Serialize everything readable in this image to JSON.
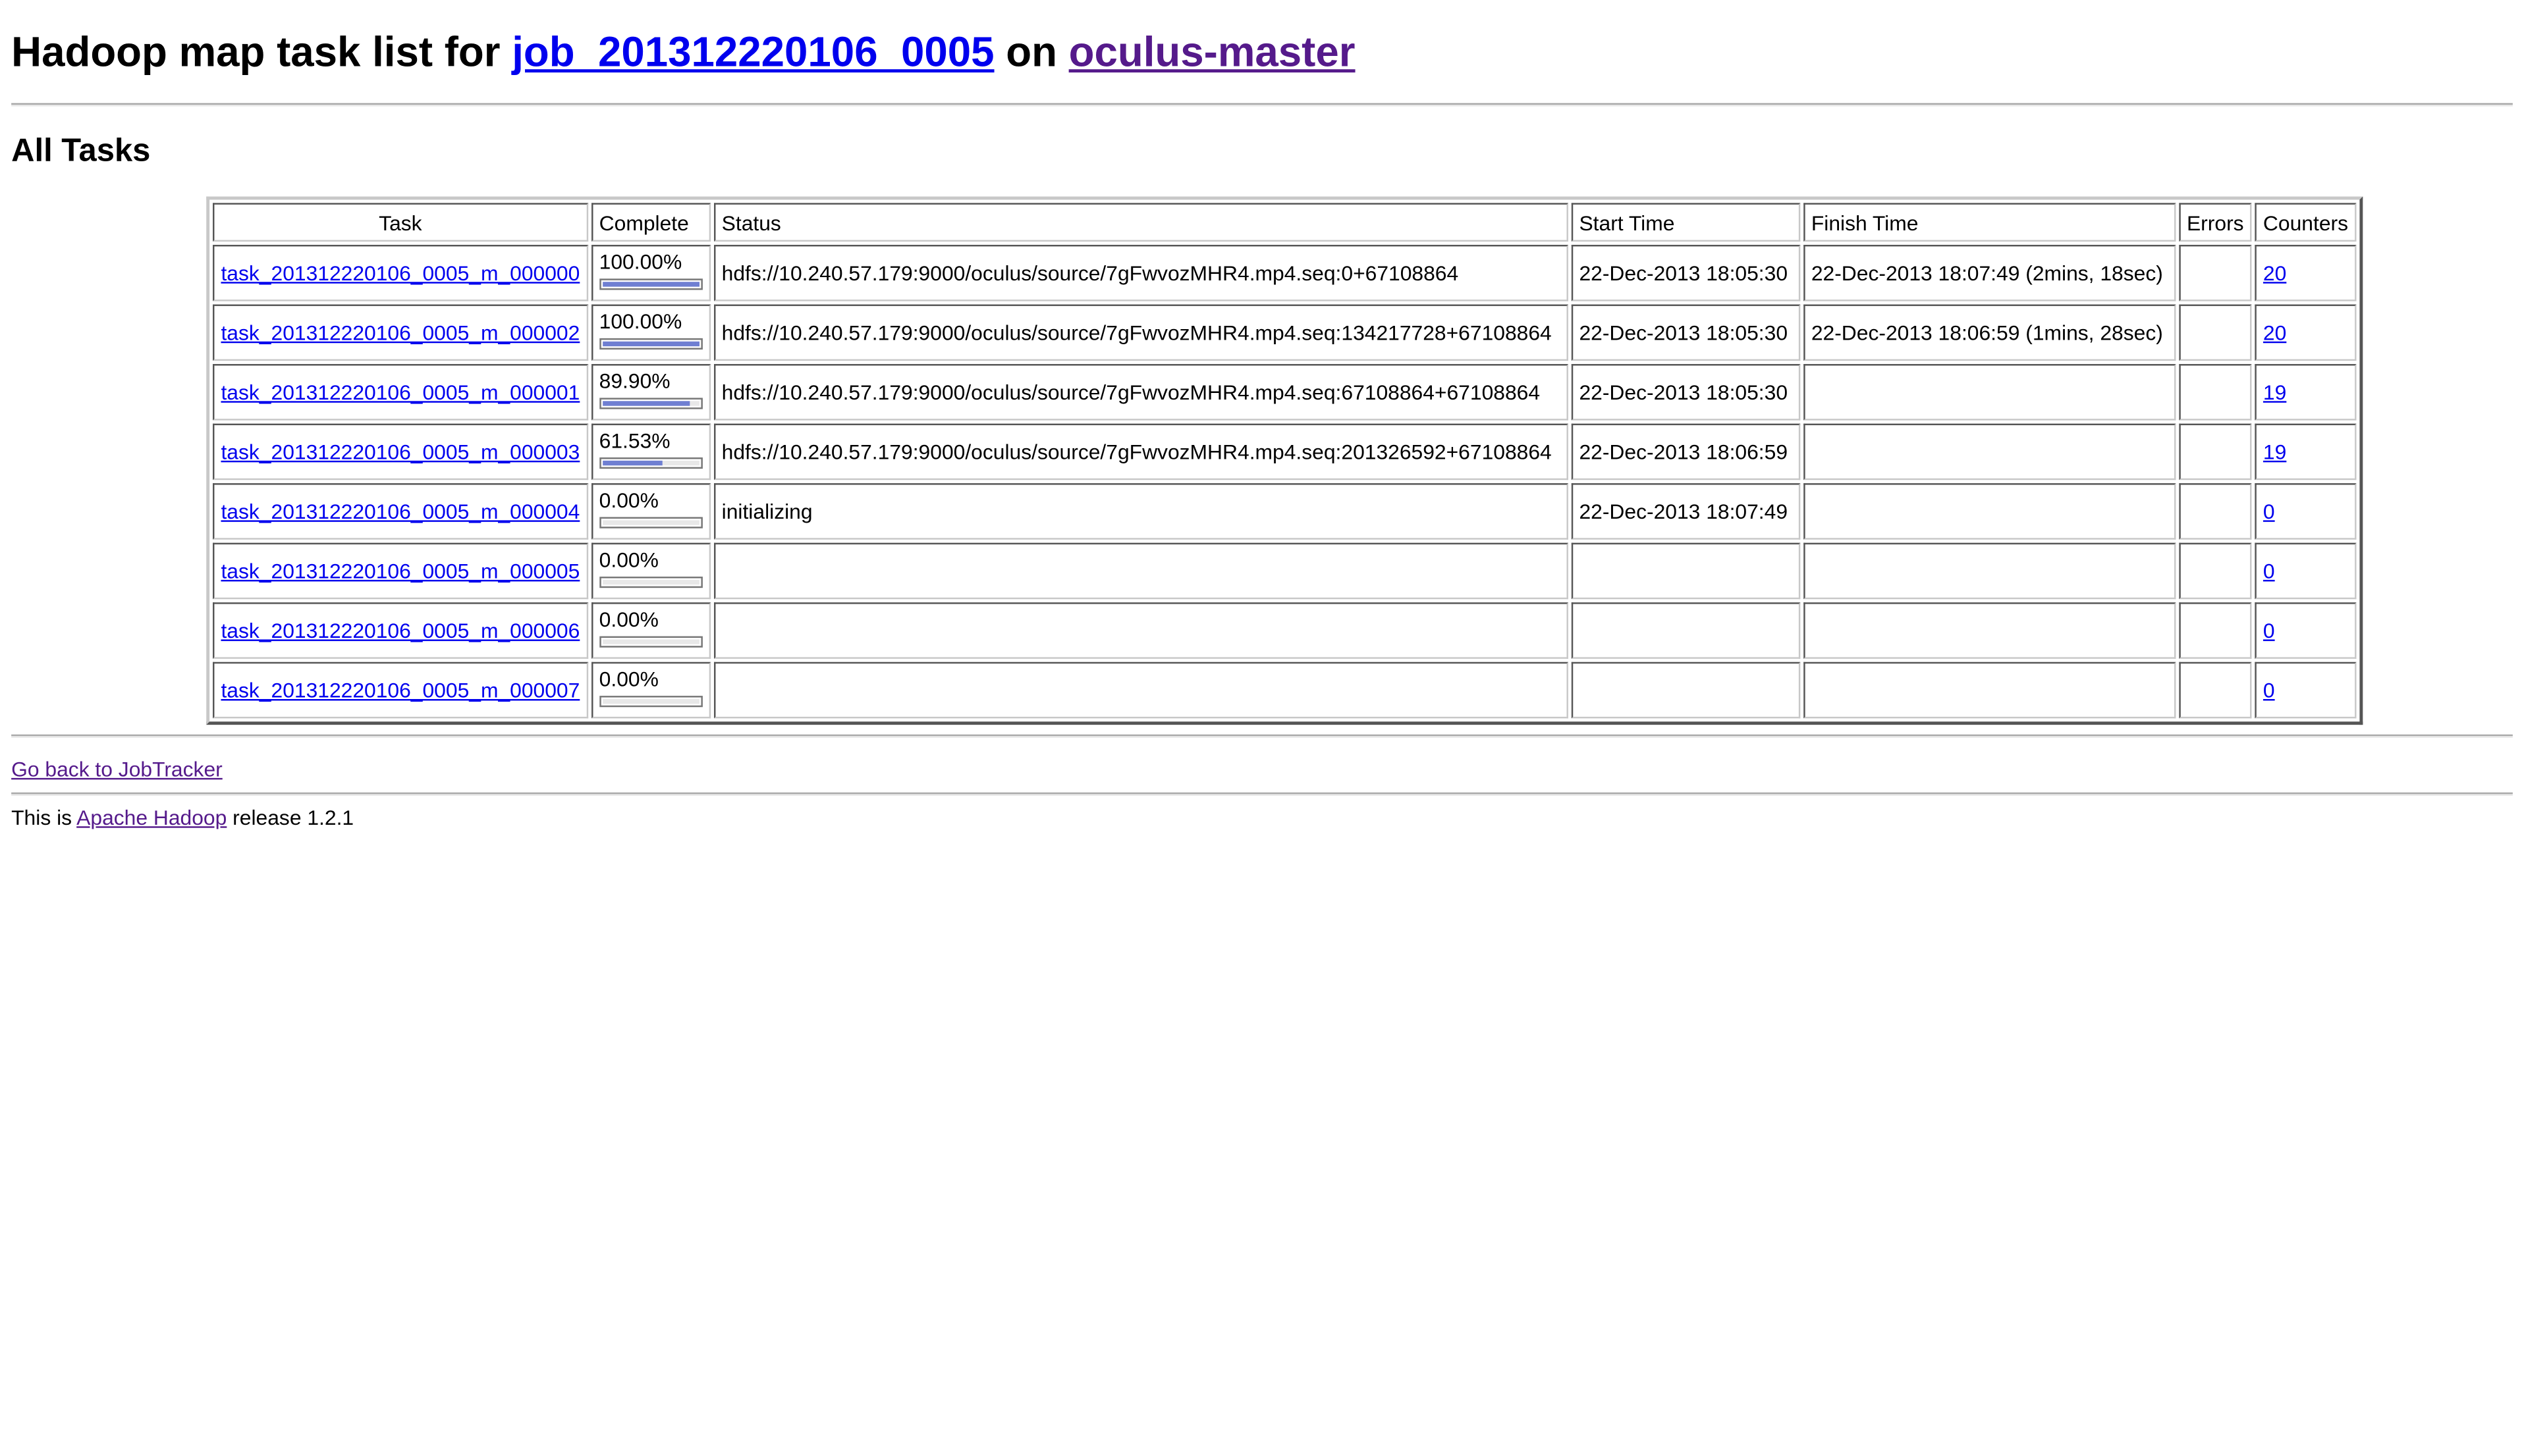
{
  "header": {
    "title_prefix": "Hadoop map task list for ",
    "job_link": "job_201312220106_0005",
    "title_middle": " on ",
    "host_link": "oculus-master"
  },
  "section": {
    "heading": "All Tasks"
  },
  "table": {
    "columns": {
      "task": "Task",
      "complete": "Complete",
      "status": "Status",
      "start_time": "Start Time",
      "finish_time": "Finish Time",
      "errors": "Errors",
      "counters": "Counters"
    },
    "rows": [
      {
        "task": "task_201312220106_0005_m_000000",
        "complete": "100.00%",
        "progress": 1.0,
        "status": "hdfs://10.240.57.179:9000/oculus/source/7gFwvozMHR4.mp4.seq:0+67108864",
        "start_time": "22-Dec-2013 18:05:30",
        "finish_time": "22-Dec-2013 18:07:49 (2mins, 18sec)",
        "errors": "",
        "counters": "20"
      },
      {
        "task": "task_201312220106_0005_m_000002",
        "complete": "100.00%",
        "progress": 1.0,
        "status": "hdfs://10.240.57.179:9000/oculus/source/7gFwvozMHR4.mp4.seq:134217728+67108864",
        "start_time": "22-Dec-2013 18:05:30",
        "finish_time": "22-Dec-2013 18:06:59 (1mins, 28sec)",
        "errors": "",
        "counters": "20"
      },
      {
        "task": "task_201312220106_0005_m_000001",
        "complete": "89.90%",
        "progress": 0.899,
        "status": "hdfs://10.240.57.179:9000/oculus/source/7gFwvozMHR4.mp4.seq:67108864+67108864",
        "start_time": "22-Dec-2013 18:05:30",
        "finish_time": "",
        "errors": "",
        "counters": "19"
      },
      {
        "task": "task_201312220106_0005_m_000003",
        "complete": "61.53%",
        "progress": 0.6153,
        "status": "hdfs://10.240.57.179:9000/oculus/source/7gFwvozMHR4.mp4.seq:201326592+67108864",
        "start_time": "22-Dec-2013 18:06:59",
        "finish_time": "",
        "errors": "",
        "counters": "19"
      },
      {
        "task": "task_201312220106_0005_m_000004",
        "complete": "0.00%",
        "progress": 0.0,
        "status": "initializing",
        "start_time": "22-Dec-2013 18:07:49",
        "finish_time": "",
        "errors": "",
        "counters": "0"
      },
      {
        "task": "task_201312220106_0005_m_000005",
        "complete": "0.00%",
        "progress": 0.0,
        "status": "",
        "start_time": "",
        "finish_time": "",
        "errors": "",
        "counters": "0"
      },
      {
        "task": "task_201312220106_0005_m_000006",
        "complete": "0.00%",
        "progress": 0.0,
        "status": "",
        "start_time": "",
        "finish_time": "",
        "errors": "",
        "counters": "0"
      },
      {
        "task": "task_201312220106_0005_m_000007",
        "complete": "0.00%",
        "progress": 0.0,
        "status": "",
        "start_time": "",
        "finish_time": "",
        "errors": "",
        "counters": "0"
      }
    ]
  },
  "footer": {
    "back_link": "Go back to JobTracker",
    "release_prefix": "This is ",
    "release_link": "Apache Hadoop",
    "release_suffix": " release 1.2.1"
  },
  "colors": {
    "link": "#0000ee",
    "visited_link": "#551a8b",
    "progress_fill": "#6f7fd2"
  }
}
